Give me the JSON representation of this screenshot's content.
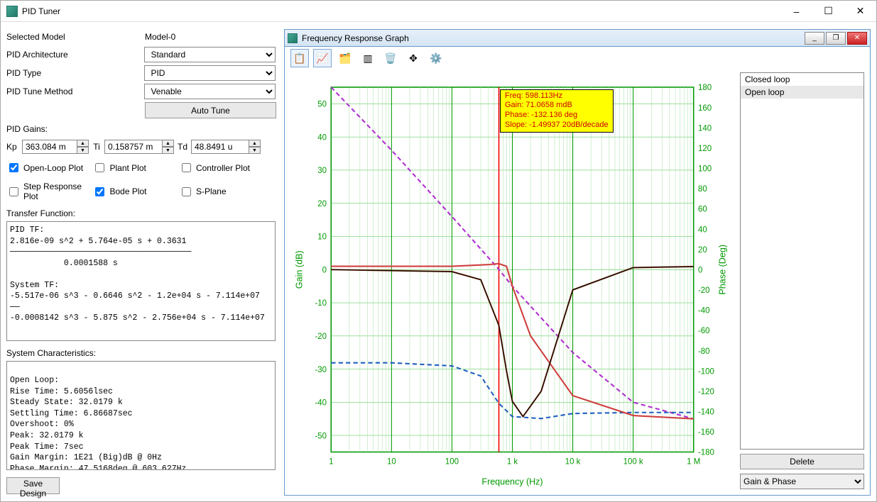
{
  "window": {
    "title": "PID Tuner"
  },
  "panel": {
    "selected_model_label": "Selected Model",
    "selected_model_value": "Model-0",
    "architecture_label": "PID Architecture",
    "architecture_value": "Standard",
    "type_label": "PID Type",
    "type_value": "PID",
    "method_label": "PID Tune Method",
    "method_value": "Venable",
    "auto_tune": "Auto Tune",
    "gains_label": "PID Gains:",
    "kp_label": "Kp",
    "kp_value": "363.084 m",
    "ti_label": "Ti",
    "ti_value": "0.158757 m",
    "td_label": "Td",
    "td_value": "48.8491 u",
    "chk_open_loop": "Open-Loop Plot",
    "chk_plant": "Plant Plot",
    "chk_controller": "Controller Plot",
    "chk_step": "Step Response Plot",
    "chk_bode": "Bode Plot",
    "chk_splane": "S-Plane",
    "tf_label": "Transfer Function:",
    "tf_text": "PID TF:\n2.816e-09 s^2 + 5.764e-05 s + 0.3631\n─────────────────────────────────────\n           0.0001588 s\n\nSystem TF:\n-5.517e-06 s^3 - 0.6646 s^2 - 1.2e+04 s - 7.114e+07\n──\n-0.0008142 s^3 - 5.875 s^2 - 2.756e+04 s - 7.114e+07",
    "sc_label": "System Characteristics:",
    "sc_text": "\nOpen Loop:\nRise Time: 5.6056lsec\nSteady State: 32.0179 k\nSettling Time: 6.86687sec\nOvershoot: 0%\nPeak: 32.0179 k\nPeak Time: 7sec\nGain Margin: 1E21 (Big)dB @ 0Hz\nPhase Margin: 47.5168deg @ 603.627Hz",
    "save_design": "Save Design"
  },
  "graph": {
    "title": "Frequency Response Graph",
    "list_closed": "Closed loop",
    "list_open": "Open loop",
    "delete": "Delete",
    "view_mode": "Gain & Phase",
    "xlabel": "Frequency (Hz)",
    "ylabel_left": "Gain (dB)",
    "ylabel_right": "Phase (Deg)",
    "cursor": {
      "l1": "Freq: 598.113Hz",
      "l2": "Gain: 71.0658 mdB",
      "l3": "Phase: -132.136 deg",
      "l4": "Slope: -1.49937 20dB/decade"
    }
  },
  "chart_data": {
    "type": "line",
    "xlabel": "Frequency (Hz)",
    "x_scale": "log",
    "xlim": [
      1,
      1000000
    ],
    "left_axis": {
      "label": "Gain (dB)",
      "ylim": [
        -55,
        55
      ],
      "ticks": [
        -50,
        -40,
        -30,
        -20,
        -10,
        0,
        10,
        20,
        30,
        40,
        50
      ]
    },
    "right_axis": {
      "label": "Phase (Deg)",
      "ylim": [
        -180,
        180
      ],
      "ticks": [
        -180,
        -160,
        -140,
        -120,
        -100,
        -80,
        -60,
        -40,
        -20,
        0,
        20,
        40,
        60,
        80,
        100,
        120,
        140,
        160,
        180
      ]
    },
    "x_ticks": [
      1,
      10,
      100,
      1000,
      10000,
      100000,
      1000000
    ],
    "x_tick_labels": [
      "1",
      "10",
      "100",
      "1 k",
      "10 k",
      "100 k",
      "1 M"
    ],
    "cursor_freq": 598.113,
    "series": [
      {
        "name": "Open loop Gain",
        "axis": "left",
        "color": "#b030d0",
        "x": [
          1,
          10,
          100,
          598,
          1000,
          10000,
          100000,
          1000000
        ],
        "y": [
          55,
          36,
          16,
          0.07,
          -5,
          -25,
          -40,
          -45
        ]
      },
      {
        "name": "Open loop Phase",
        "axis": "right",
        "color": "#2060c0",
        "x": [
          1,
          10,
          100,
          300,
          598,
          1000,
          3000,
          10000,
          100000,
          1000000
        ],
        "y": [
          -92,
          -92,
          -95,
          -105,
          -132,
          -145,
          -147,
          -142,
          -141,
          -141
        ]
      },
      {
        "name": "Closed loop Gain",
        "axis": "left",
        "color": "#d04040",
        "x": [
          1,
          100,
          400,
          598,
          800,
          1000,
          2000,
          10000,
          100000,
          1000000
        ],
        "y": [
          1,
          1,
          1.5,
          1.8,
          1,
          -5,
          -20,
          -38,
          -44,
          -45
        ]
      },
      {
        "name": "Closed loop Phase",
        "axis": "right",
        "color": "#8a3a1a",
        "x": [
          1,
          100,
          300,
          598,
          800,
          1000,
          1500,
          3000,
          10000,
          100000,
          1000000
        ],
        "y": [
          0,
          -2,
          -10,
          -55,
          -100,
          -130,
          -145,
          -120,
          -20,
          2,
          3
        ]
      }
    ]
  }
}
